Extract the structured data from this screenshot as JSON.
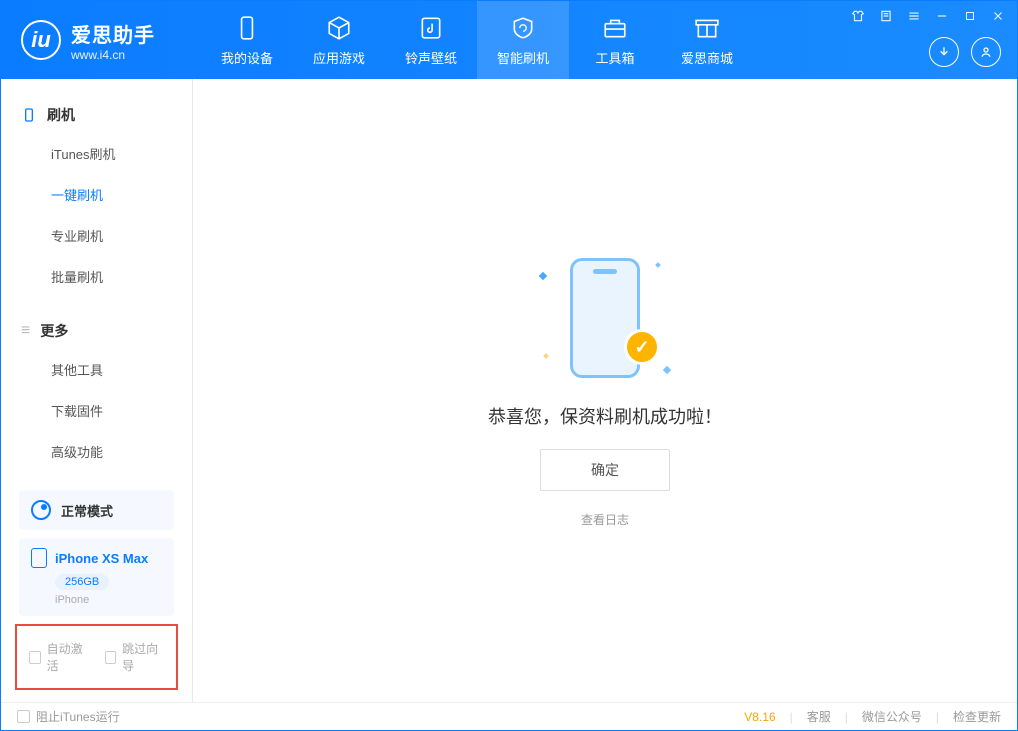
{
  "app": {
    "title": "爱思助手",
    "url": "www.i4.cn"
  },
  "nav": {
    "tabs": [
      {
        "label": "我的设备"
      },
      {
        "label": "应用游戏"
      },
      {
        "label": "铃声壁纸"
      },
      {
        "label": "智能刷机"
      },
      {
        "label": "工具箱"
      },
      {
        "label": "爱思商城"
      }
    ]
  },
  "sidebar": {
    "section1_title": "刷机",
    "items1": [
      {
        "label": "iTunes刷机"
      },
      {
        "label": "一键刷机"
      },
      {
        "label": "专业刷机"
      },
      {
        "label": "批量刷机"
      }
    ],
    "section2_title": "更多",
    "items2": [
      {
        "label": "其他工具"
      },
      {
        "label": "下载固件"
      },
      {
        "label": "高级功能"
      }
    ],
    "mode": "正常模式",
    "device": {
      "name": "iPhone XS Max",
      "storage": "256GB",
      "type": "iPhone"
    },
    "opt1": "自动激活",
    "opt2": "跳过向导"
  },
  "main": {
    "success": "恭喜您，保资料刷机成功啦！",
    "confirm": "确定",
    "view_log": "查看日志"
  },
  "footer": {
    "block_itunes": "阻止iTunes运行",
    "version": "V8.16",
    "links": [
      "客服",
      "微信公众号",
      "检查更新"
    ]
  }
}
